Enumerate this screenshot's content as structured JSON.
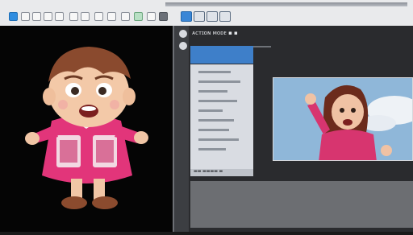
{
  "topbar": {
    "left_icons": [
      "app-icon",
      "new-icon",
      "open-icon",
      "save-icon",
      "cut-icon",
      "copy-icon",
      "paste-icon",
      "undo-icon",
      "shield-icon",
      "brush-icon",
      "color-icon",
      "image-icon",
      "display-icon"
    ]
  },
  "right_panel": {
    "toolbar": [
      "preview-mode-button",
      "split-mode-button",
      "layout-button",
      "screen-button"
    ],
    "title_text": "ᴀᴄᴛɪᴏɴ ᴍᴏᴅᴇ ▪ ▪"
  },
  "footer": {
    "text": "▬▬ ▬▬▬▬ ▬"
  },
  "colors": {
    "toolbar_bg": "#e9eaec",
    "panel_header": "#3e7fc9",
    "dark_bg": "#050505"
  }
}
